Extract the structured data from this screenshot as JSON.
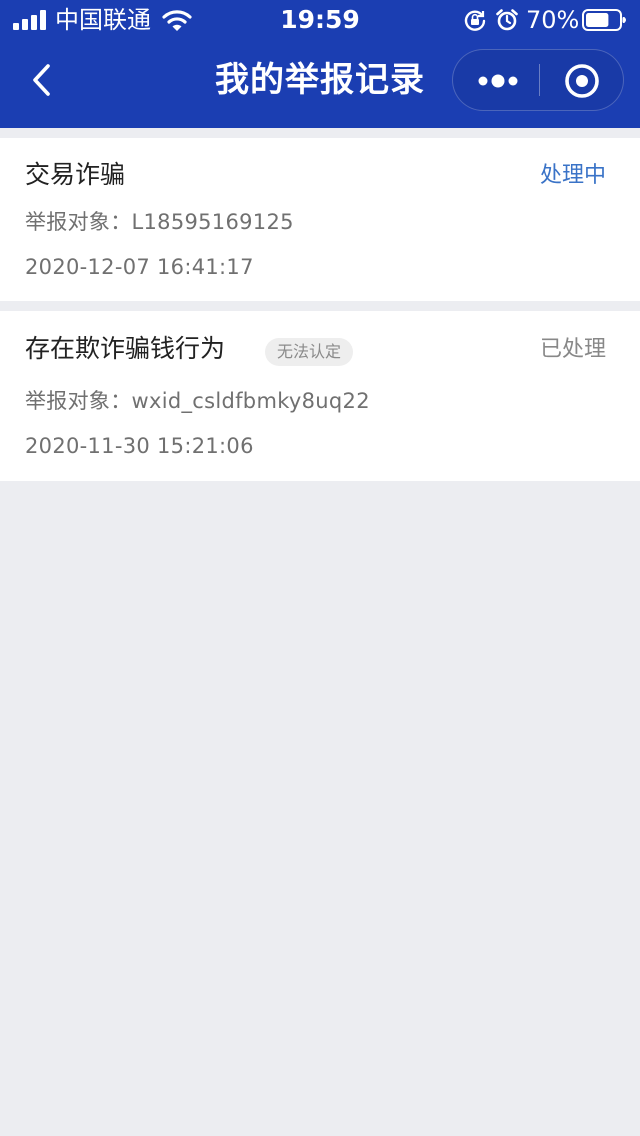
{
  "status_bar": {
    "carrier": "中国联通",
    "time": "19:59",
    "battery_percent": "70%",
    "battery_level": 0.7,
    "icons": [
      "signal-icon",
      "wifi-icon",
      "orientation-lock-icon",
      "alarm-icon",
      "battery-icon"
    ]
  },
  "nav": {
    "title": "我的举报记录",
    "back_icon": "chevron-left-icon",
    "more_icon": "more-dots-icon",
    "close_icon": "target-circle-icon"
  },
  "colors": {
    "header_bg": "#1b3eb2",
    "page_bg": "#ecedf1",
    "status_processing": "#3a73c7",
    "status_done": "#888888"
  },
  "reports": [
    {
      "title": "交易诈骗",
      "tag": "",
      "status": "处理中",
      "target": "举报对象：L18595169125",
      "date": "2020-12-07 16:41:17"
    },
    {
      "title": "存在欺诈骗钱行为",
      "tag": "无法认定",
      "status": "已处理",
      "target": "举报对象：wxid_csldfbmky8uq22",
      "date": "2020-11-30 15:21:06"
    }
  ]
}
